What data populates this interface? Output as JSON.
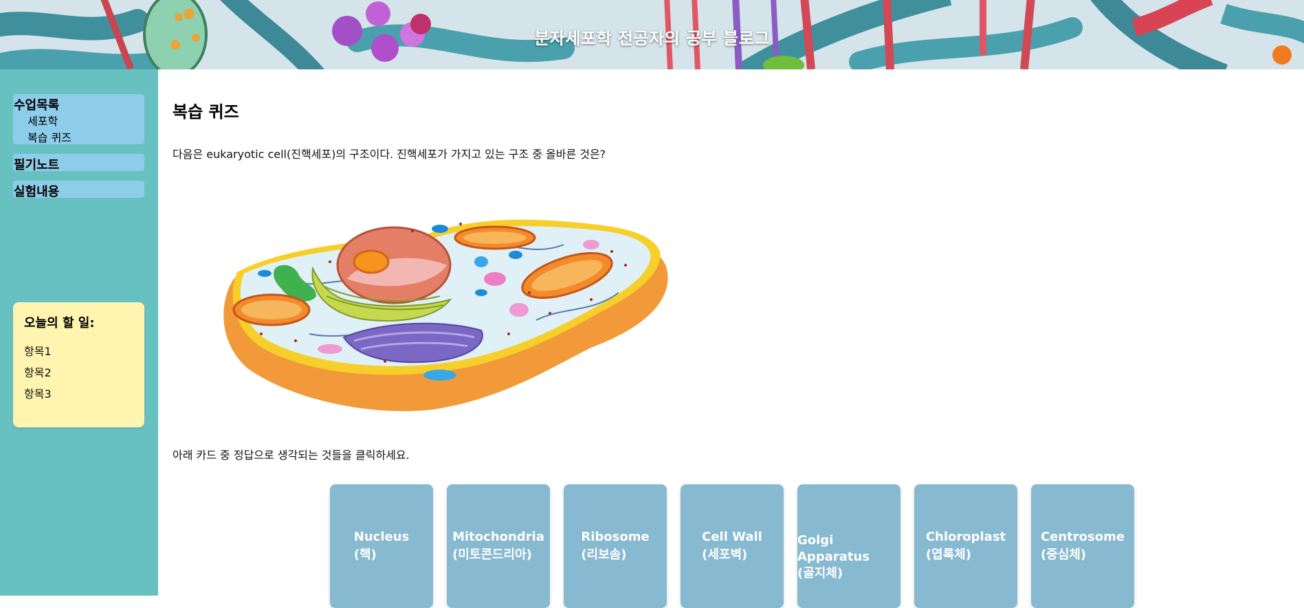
{
  "header": {
    "title": "분자세포학 전공자의 공부 블로그"
  },
  "sidebar": {
    "groups": [
      {
        "label": "수업목록",
        "items": [
          "세포학",
          "복습 퀴즈"
        ]
      },
      {
        "label": "필기노트"
      },
      {
        "label": "실험내용"
      }
    ],
    "todo": {
      "title": "오늘의 할 일:",
      "items": [
        "항목1",
        "항목2",
        "항목3"
      ]
    }
  },
  "main": {
    "title": "복습 퀴즈",
    "question": "다음은 eukaryotic cell(진핵세포)의 구조이다. 진핵세포가 가지고 있는 구조 중 올바른 것은?",
    "instruction": "아래 카드 중 정답으로 생각되는 것들을 클릭하세요.",
    "cards": [
      {
        "line1": "Nucleus",
        "line2": "(핵)"
      },
      {
        "line1": "Mitochondria",
        "line2": "(미토콘드리아)"
      },
      {
        "line1": "Ribosome",
        "line2": "(리보솜)"
      },
      {
        "line1": "Cell Wall",
        "line2": "(세포벽)"
      },
      {
        "line1": "Golgi",
        "line2": "Apparatus",
        "line3": "(골지체)"
      },
      {
        "line1": "Chloroplast",
        "line2": "(엽록체)"
      },
      {
        "line1": "Centrosome",
        "line2": "(중심체)"
      }
    ]
  },
  "colors": {
    "sidebar": "#68c1c1",
    "nav": "#8dcde9",
    "todo": "#fff5b1",
    "card": "#87b9d1"
  }
}
